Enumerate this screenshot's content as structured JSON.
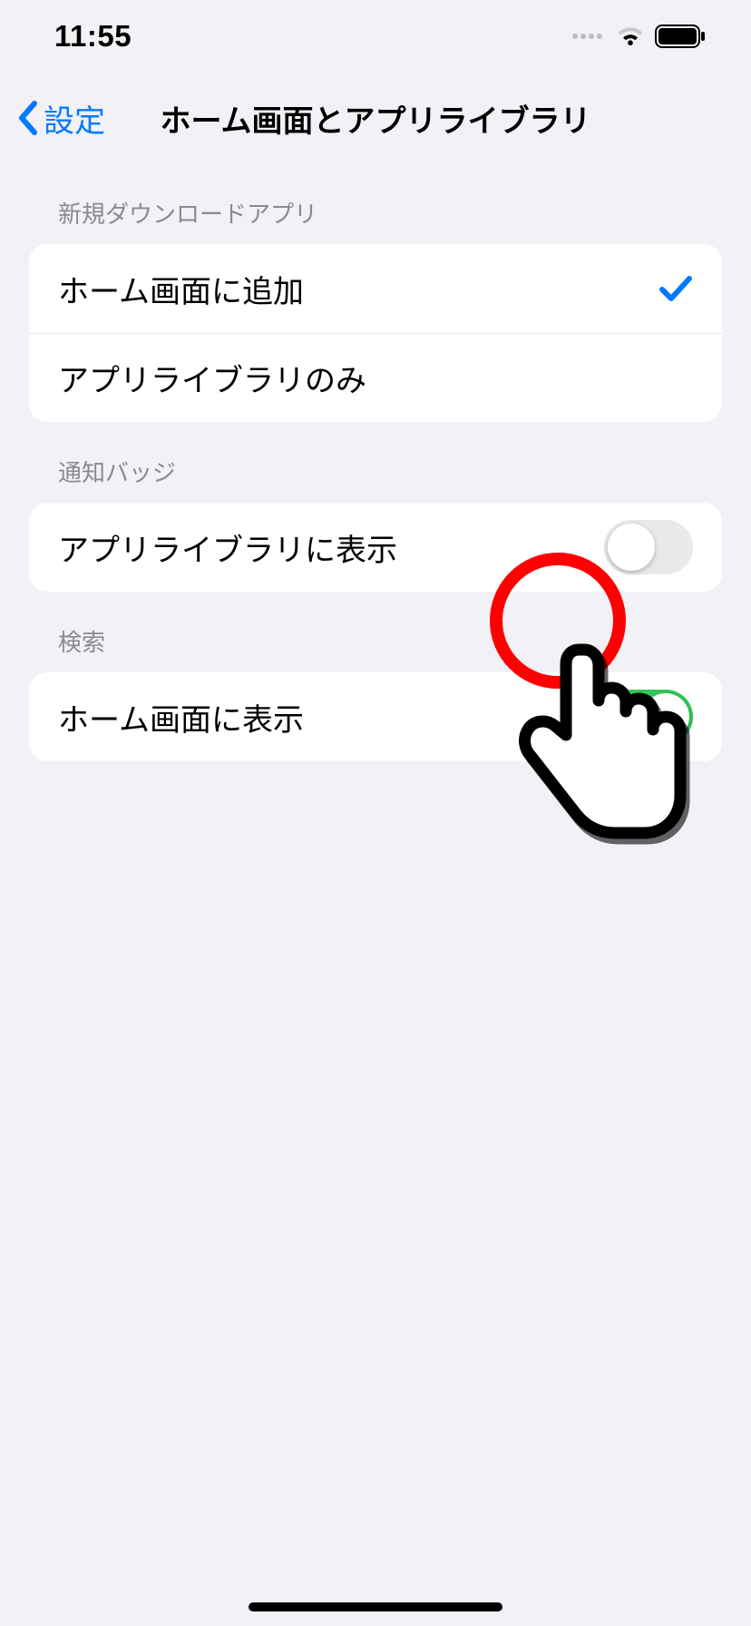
{
  "status": {
    "time": "11:55"
  },
  "nav": {
    "back_label": "設定",
    "title": "ホーム画面とアプリライブラリ"
  },
  "section_downloads": {
    "header": "新規ダウンロードアプリ",
    "options": [
      {
        "label": "ホーム画面に追加",
        "selected": true
      },
      {
        "label": "アプリライブラリのみ",
        "selected": false
      }
    ]
  },
  "section_badges": {
    "header": "通知バッジ",
    "row_label": "アプリライブラリに表示",
    "toggle_on": false
  },
  "section_search": {
    "header": "検索",
    "row_label": "ホーム画面に表示",
    "toggle_on": true
  },
  "colors": {
    "accent": "#007aff",
    "toggle_on": "#34c759",
    "highlight": "#ff0000"
  }
}
